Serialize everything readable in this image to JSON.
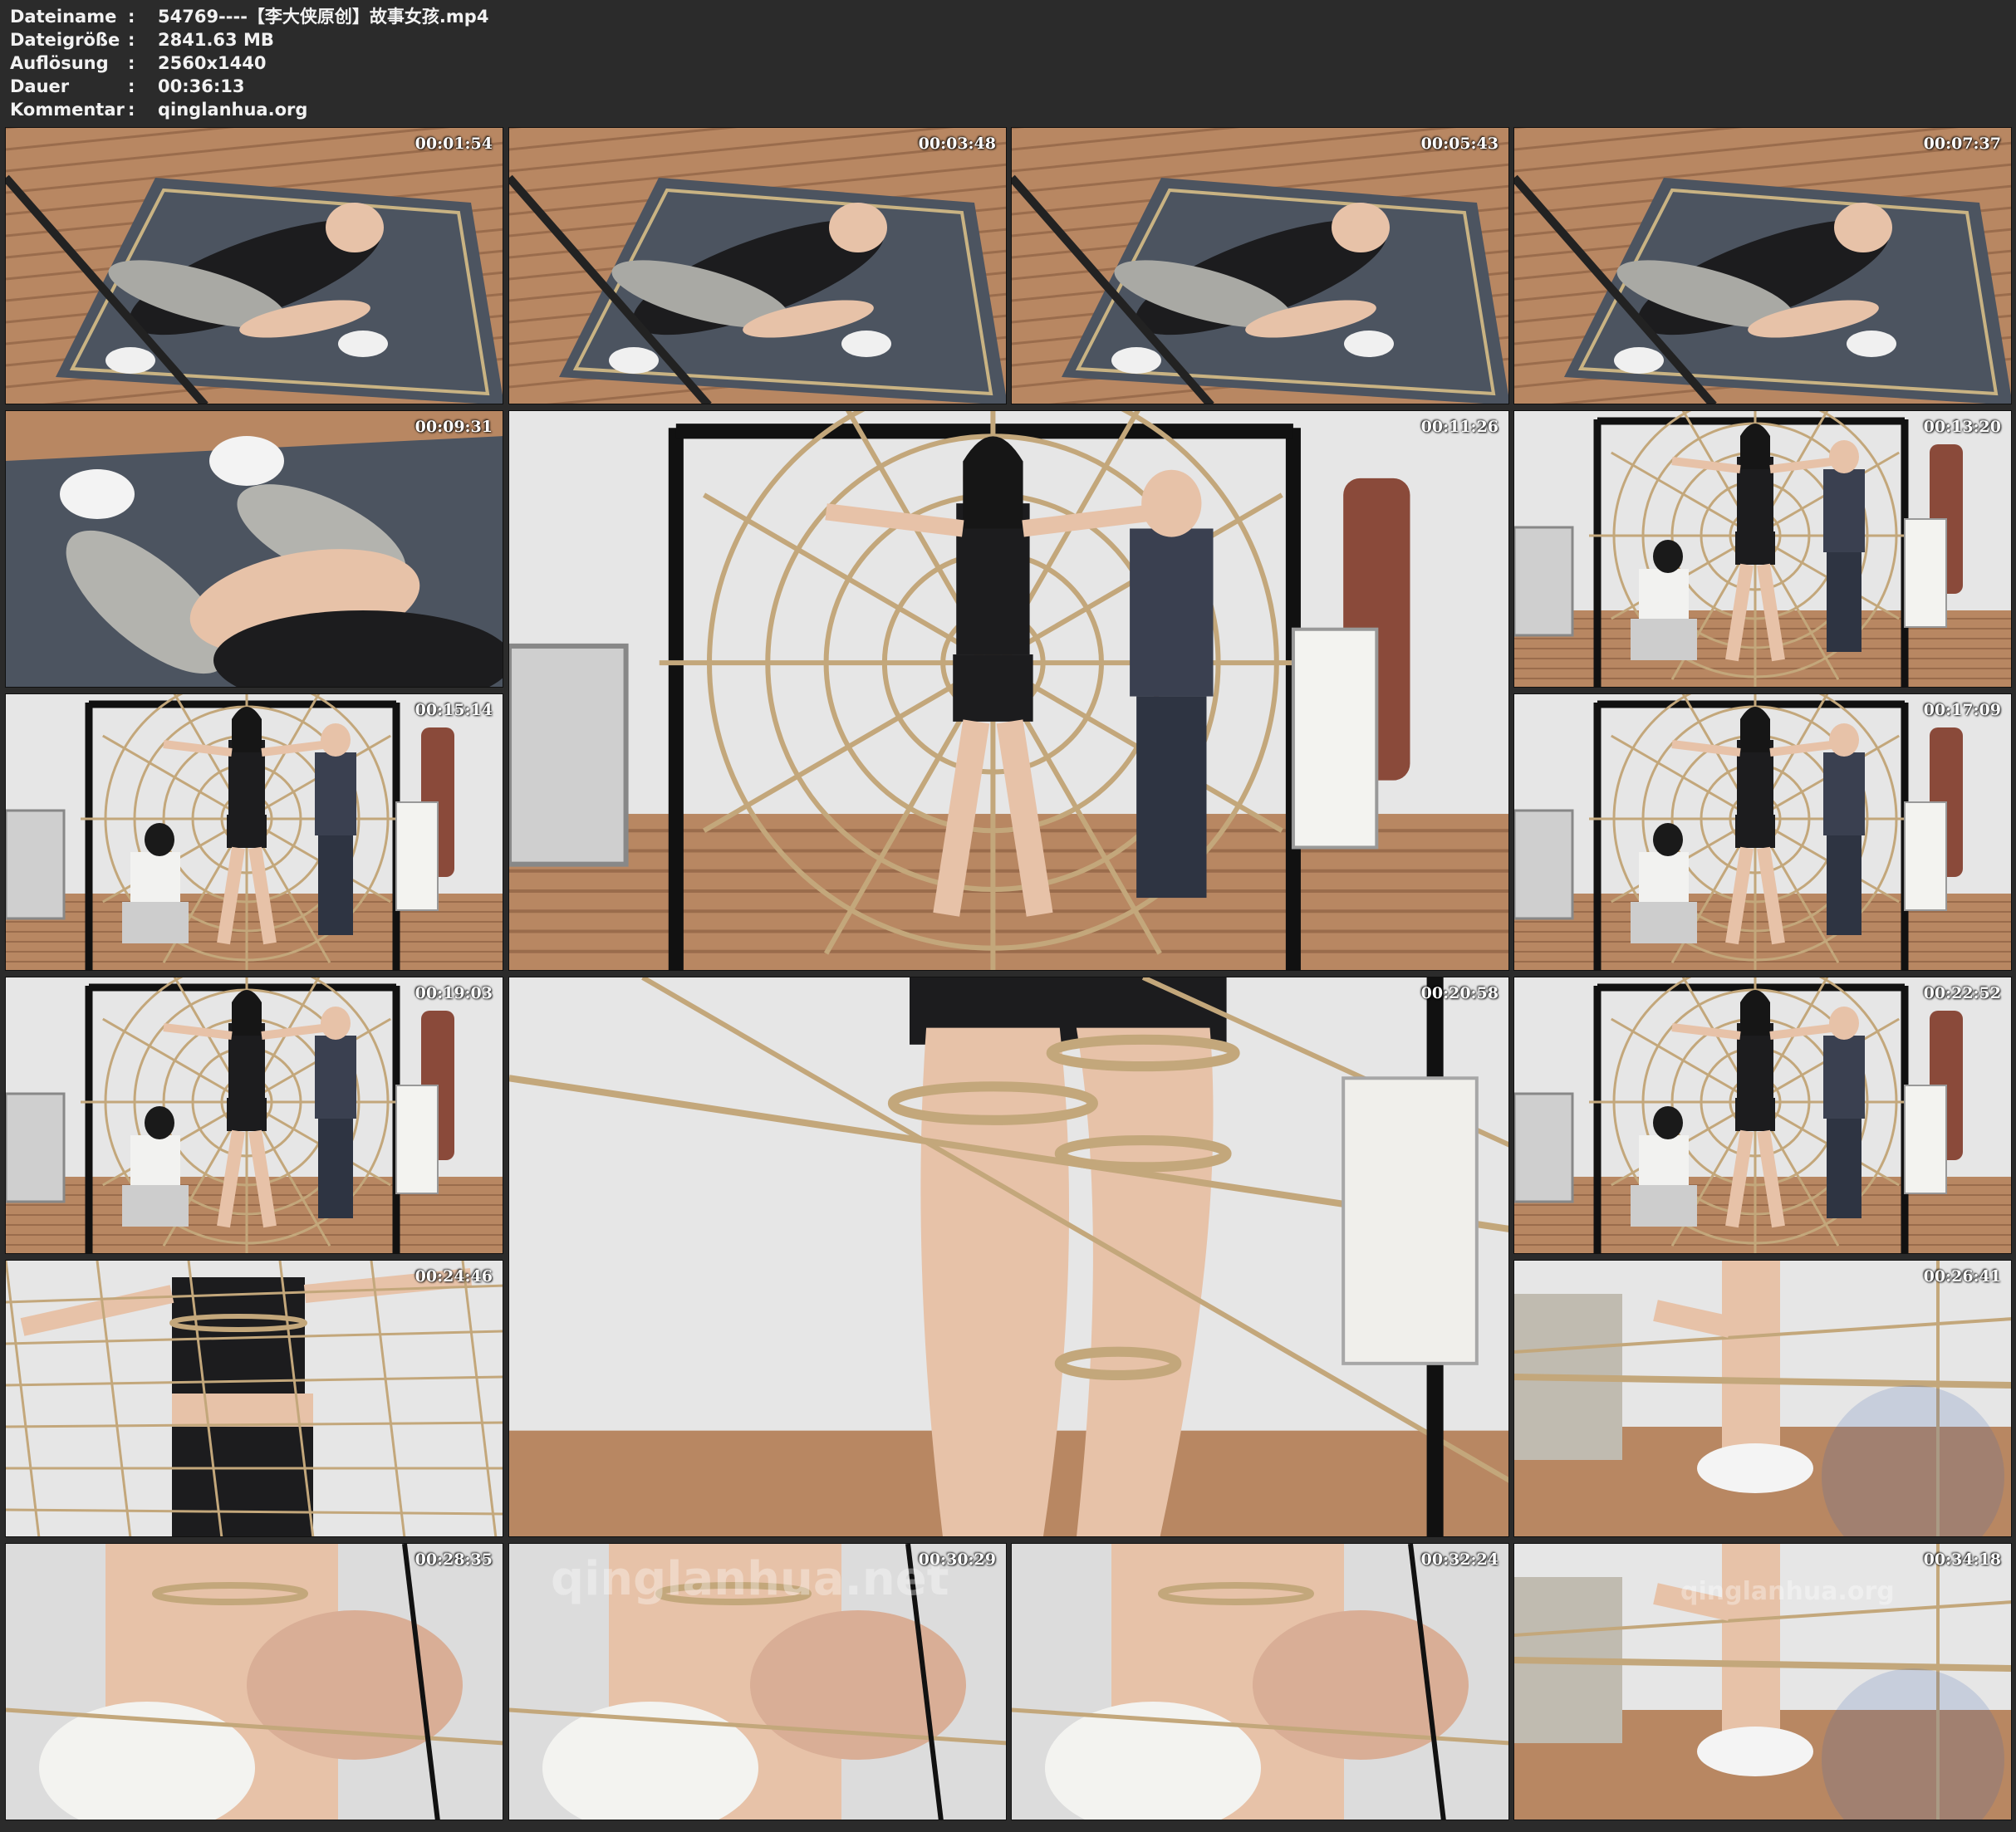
{
  "header": {
    "rows": [
      {
        "key": "Dateiname",
        "sep": ":",
        "value": "54769----【李大侠原创】故事女孩.mp4"
      },
      {
        "key": "Dateigröße",
        "sep": ":",
        "value": "2841.63 MB"
      },
      {
        "key": "Auflösung",
        "sep": ":",
        "value": "2560x1440"
      },
      {
        "key": "Dauer",
        "sep": ":",
        "value": "00:36:13"
      },
      {
        "key": "Kommentar",
        "sep": ":",
        "value": "qinglanhua.org"
      }
    ]
  },
  "thumbnails": [
    {
      "time": "00:01:54",
      "scene": "floor-wrestling"
    },
    {
      "time": "00:03:48",
      "scene": "floor-wrestling"
    },
    {
      "time": "00:05:43",
      "scene": "floor-wrestling"
    },
    {
      "time": "00:07:37",
      "scene": "floor-wrestling"
    },
    {
      "time": "00:09:31",
      "scene": "legs-closeup"
    },
    {
      "time": "00:11:26",
      "scene": "rope-web-large"
    },
    {
      "time": "00:13:20",
      "scene": "rope-web"
    },
    {
      "time": "00:15:14",
      "scene": "rope-web"
    },
    {
      "time": "00:17:09",
      "scene": "rope-web"
    },
    {
      "time": "00:19:03",
      "scene": "rope-web"
    },
    {
      "time": "00:20:58",
      "scene": "legs-rope-large"
    },
    {
      "time": "00:22:52",
      "scene": "rope-web"
    },
    {
      "time": "00:24:46",
      "scene": "torso-rope"
    },
    {
      "time": "00:26:41",
      "scene": "ankle-rope"
    },
    {
      "time": "00:28:35",
      "scene": "closeup"
    },
    {
      "time": "00:30:29",
      "scene": "closeup"
    },
    {
      "time": "00:32:24",
      "scene": "closeup"
    },
    {
      "time": "00:34:18",
      "scene": "ankle-rope"
    }
  ],
  "watermarks": {
    "large": "qinglanhua.net",
    "small": "qinglanhua.org"
  },
  "colors": {
    "background": "#2b2b2b",
    "wood_floor": "#b88762",
    "carpet": "#4c5460",
    "wall": "#e6e6e6",
    "rope": "#c3a77b",
    "skin": "#e7c2a8",
    "clothing_black": "#1c1c1e"
  }
}
